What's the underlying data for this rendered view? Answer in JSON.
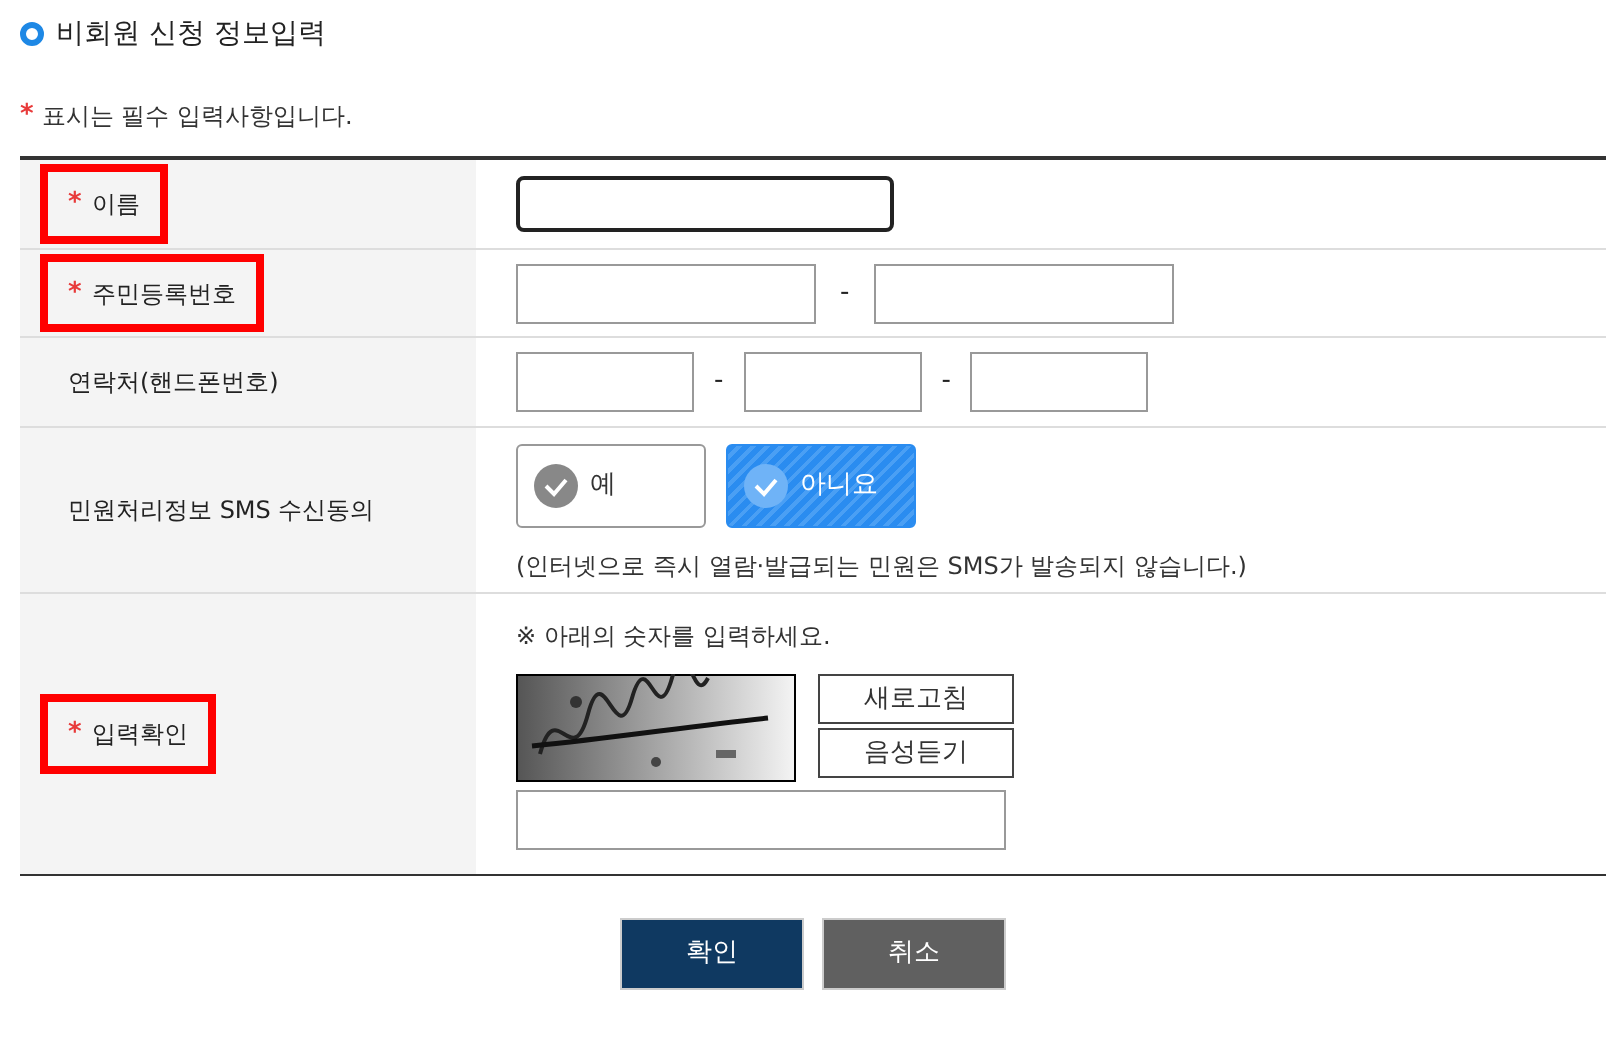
{
  "title": "비회원 신청 정보입력",
  "required_note": {
    "mark": "*",
    "text": "표시는 필수 입력사항입니다."
  },
  "rows": [
    {
      "kind": "text",
      "label": "이름",
      "required_mark": "*",
      "highlighted": true,
      "fields": [
        {
          "focused": true
        }
      ]
    },
    {
      "kind": "text",
      "label": "주민등록번호",
      "required_mark": "*",
      "highlighted": true,
      "separator": "-",
      "fields": [
        {
          "focused": false
        },
        {
          "focused": false
        }
      ]
    },
    {
      "kind": "text",
      "label": "연락처(핸드폰번호)",
      "highlighted": false,
      "separator": "-",
      "fields": [
        {
          "focused": false
        },
        {
          "focused": false
        },
        {
          "focused": false
        }
      ]
    },
    {
      "kind": "choice",
      "label": "민원처리정보 SMS 수신동의",
      "highlighted": false,
      "options": [
        {
          "label": "예",
          "selected": false
        },
        {
          "label": "아니요",
          "selected": true
        }
      ],
      "note": "(인터넷으로 즉시 열람·발급되는 민원은 SMS가 발송되지 않습니다.)"
    },
    {
      "kind": "captcha",
      "label": "입력확인",
      "required_mark": "*",
      "highlighted": true,
      "instruction": "※ 아래의 숫자를 입력하세요.",
      "image": {
        "kind": "picture"
      },
      "buttons": [
        "새로고침",
        "음성듣기"
      ]
    }
  ],
  "buttons": [
    {
      "label": "확인",
      "kind": "primary"
    },
    {
      "label": "취소",
      "kind": "secondary"
    }
  ]
}
